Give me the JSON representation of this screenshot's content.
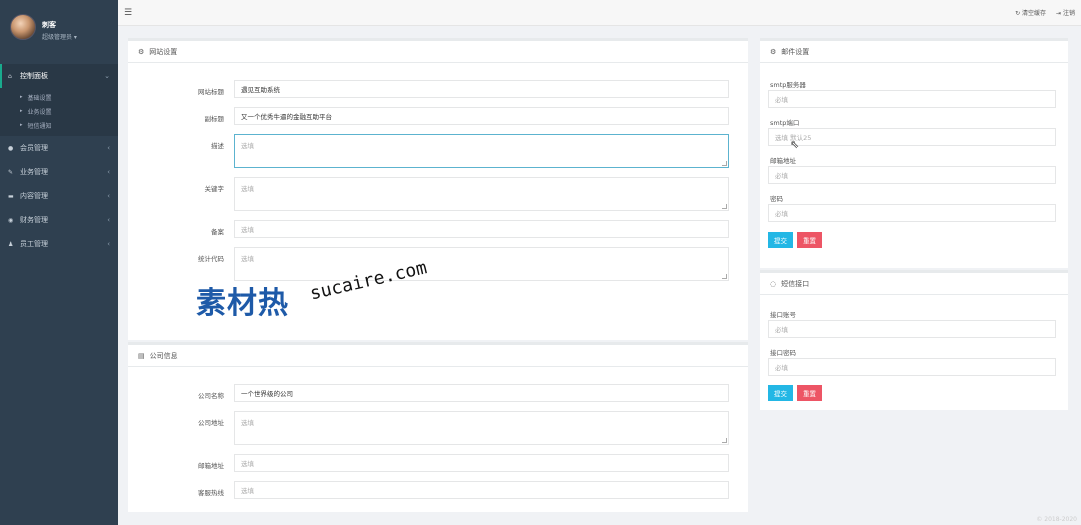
{
  "profile": {
    "name": "刺客",
    "role": "超级管理员 ▾"
  },
  "nav": {
    "items": [
      {
        "label": "控制面板",
        "icon": "home-icon",
        "active": true,
        "sub": [
          "基础设置",
          "业务设置",
          "短信通知"
        ]
      },
      {
        "label": "会员管理",
        "icon": "user-icon"
      },
      {
        "label": "业务管理",
        "icon": "tag-icon"
      },
      {
        "label": "内容管理",
        "icon": "folder-icon"
      },
      {
        "label": "财务管理",
        "icon": "coin-icon"
      },
      {
        "label": "员工管理",
        "icon": "person-icon"
      }
    ]
  },
  "topbar": {
    "clear_cache": "清空缓存",
    "logout": "注销"
  },
  "site": {
    "title": "网站设置",
    "fields": [
      {
        "label": "网站标题",
        "value": "遇见互助系统",
        "placeholder": ""
      },
      {
        "label": "副标题",
        "value": "又一个优秀牛逼的金融互助平台",
        "placeholder": ""
      },
      {
        "label": "描述",
        "value": "",
        "placeholder": "选填"
      },
      {
        "label": "关键字",
        "value": "",
        "placeholder": "选填"
      },
      {
        "label": "备案",
        "value": "",
        "placeholder": "选填"
      },
      {
        "label": "统计代码",
        "value": "",
        "placeholder": "选填"
      }
    ]
  },
  "company": {
    "title": "公司信息",
    "fields": [
      {
        "label": "公司名称",
        "value": "一个世界级的公司",
        "placeholder": ""
      },
      {
        "label": "公司地址",
        "value": "",
        "placeholder": "选填"
      },
      {
        "label": "邮箱地址",
        "value": "",
        "placeholder": "选填"
      },
      {
        "label": "客服热线",
        "value": "",
        "placeholder": "选填"
      }
    ]
  },
  "mail": {
    "title": "邮件设置",
    "fields": [
      {
        "label": "smtp服务器",
        "placeholder": "必填"
      },
      {
        "label": "smtp端口",
        "placeholder": "选填 默认25"
      },
      {
        "label": "邮箱地址",
        "placeholder": "必填"
      },
      {
        "label": "密码",
        "placeholder": "必填"
      }
    ],
    "submit": "提交",
    "reset": "重置"
  },
  "sms": {
    "title": "短信接口",
    "fields": [
      {
        "label": "接口账号",
        "placeholder": "必填"
      },
      {
        "label": "接口密码",
        "placeholder": "必填"
      }
    ],
    "submit": "提交",
    "reset": "重置"
  },
  "watermark": {
    "logo": "素材热",
    "site": "sucaire.com"
  },
  "footer": "© 2018-2020",
  "colors": {
    "sidebar": "#2f4050",
    "accent": "#19aa8d",
    "primary": "#23b7e5",
    "danger": "#ed5565"
  }
}
